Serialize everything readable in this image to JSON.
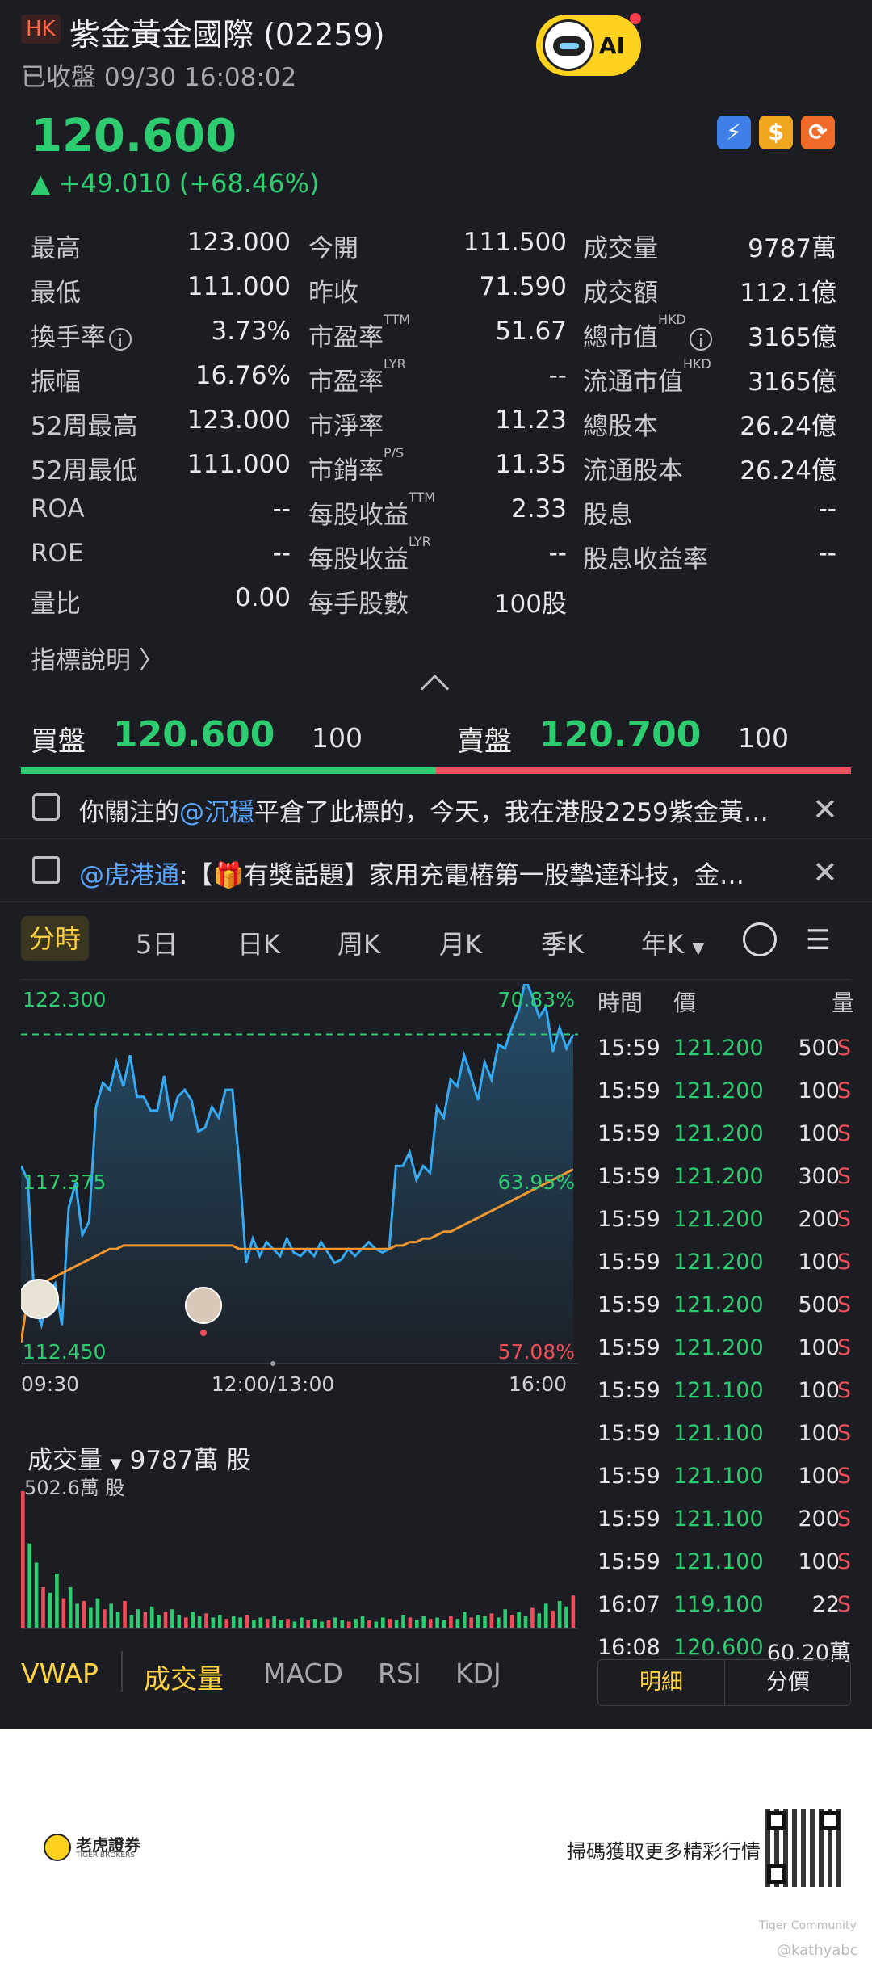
{
  "header": {
    "market": "HK",
    "title": "紫金黃金國際 (02259)",
    "status": "已收盤 09/30 16:08:02",
    "ai_label": "AI"
  },
  "quote": {
    "price": "120.600",
    "change": "▲ +49.010 (+68.46%)"
  },
  "stats": {
    "rows": [
      [
        {
          "l": "最高",
          "v": "123.000"
        },
        {
          "l": "今開",
          "v": "111.500"
        },
        {
          "l": "成交量",
          "v": "9787萬"
        }
      ],
      [
        {
          "l": "最低",
          "v": "111.000"
        },
        {
          "l": "昨收",
          "v": "71.590"
        },
        {
          "l": "成交額",
          "v": "112.1億"
        }
      ],
      [
        {
          "l": "換手率",
          "v": "3.73%"
        },
        {
          "l": "市盈率",
          "sup": "TTM",
          "v": "51.67"
        },
        {
          "l": "總市值",
          "sup": "HKD",
          "v": "3165億"
        }
      ],
      [
        {
          "l": "振幅",
          "v": "16.76%"
        },
        {
          "l": "市盈率",
          "sup": "LYR",
          "v": "--"
        },
        {
          "l": "流通市值",
          "sup": "HKD",
          "v": "3165億"
        }
      ],
      [
        {
          "l": "52周最高",
          "v": "123.000"
        },
        {
          "l": "市淨率",
          "v": "11.23"
        },
        {
          "l": "總股本",
          "v": "26.24億"
        }
      ],
      [
        {
          "l": "52周最低",
          "v": "111.000"
        },
        {
          "l": "市銷率",
          "sup": "P/S",
          "v": "11.35"
        },
        {
          "l": "流通股本",
          "v": "26.24億"
        }
      ],
      [
        {
          "l": "ROA",
          "v": "--"
        },
        {
          "l": "每股收益",
          "sup": "TTM",
          "v": "2.33"
        },
        {
          "l": "股息",
          "v": "--"
        }
      ],
      [
        {
          "l": "ROE",
          "v": "--"
        },
        {
          "l": "每股收益",
          "sup": "LYR",
          "v": "--"
        },
        {
          "l": "股息收益率",
          "v": "--"
        }
      ],
      [
        {
          "l": "量比",
          "v": "0.00"
        },
        {
          "l": "每手股數",
          "v": "100股"
        },
        {
          "l": "",
          "v": ""
        }
      ]
    ],
    "indicator_link": "指標說明 〉"
  },
  "orderbook": {
    "bid_label": "買盤",
    "bid_price": "120.600",
    "bid_qty": "100",
    "ask_label": "賣盤",
    "ask_price": "120.700",
    "ask_qty": "100"
  },
  "notices": [
    {
      "pre": "你關注的",
      "mention": "@沉穩",
      "post": "平倉了此標的，今天，我在港股2259紫金黃…"
    },
    {
      "pre": "",
      "mention": "@虎港通",
      "post": ":【🎁有獎話題】家用充電樁第一股摯達科技，金…"
    }
  ],
  "tabs": {
    "active": "分時",
    "items": [
      "5日",
      "日K",
      "周K",
      "月K",
      "季K",
      "年K"
    ]
  },
  "chart_data": {
    "type": "line",
    "x_ticks": [
      "09:30",
      "12:00/13:00",
      "16:00"
    ],
    "y_left": [
      "122.300",
      "117.375",
      "112.450"
    ],
    "y_right": [
      "70.83%",
      "63.95%",
      "57.08%"
    ],
    "ylim": [
      112.45,
      122.3
    ],
    "prev_close": 71.59,
    "series": [
      {
        "values": [
          117.6,
          117.2,
          113.6,
          113.0,
          113.9,
          114.2,
          113.0,
          116.4,
          117.1,
          115.6,
          116.0,
          119.3,
          120.0,
          119.8,
          120.6,
          119.9,
          120.8,
          119.6,
          119.6,
          119.2,
          119.2,
          120.2,
          118.9,
          119.6,
          119.8,
          119.5,
          118.6,
          118.7,
          119.3,
          119.0,
          119.8,
          119.8,
          117.7,
          114.8,
          115.5,
          115.0,
          115.4,
          115.2,
          115.0,
          115.5,
          115.1,
          115.0,
          115.2,
          115.0,
          115.4,
          115.1,
          114.8,
          114.9,
          115.2,
          115.0,
          115.2,
          115.4,
          115.2,
          115.1,
          115.2,
          117.6,
          117.6,
          118.0,
          117.2,
          117.6,
          117.4,
          119.3,
          119.0,
          120.1,
          119.9,
          120.8,
          120.2,
          119.5,
          120.6,
          120.1,
          121.1,
          121.0,
          121.6,
          122.1,
          123.0,
          122.5,
          121.9,
          122.2,
          120.9,
          121.6,
          121.0,
          121.4
        ]
      },
      {
        "values": [
          112.5,
          113.8,
          114.0,
          114.2,
          114.3,
          114.4,
          114.5,
          114.6,
          114.7,
          114.8,
          114.9,
          115.0,
          115.1,
          115.2,
          115.2,
          115.3,
          115.3,
          115.3,
          115.3,
          115.3,
          115.3,
          115.3,
          115.3,
          115.3,
          115.3,
          115.3,
          115.3,
          115.3,
          115.3,
          115.3,
          115.3,
          115.3,
          115.2,
          115.2,
          115.2,
          115.2,
          115.2,
          115.2,
          115.2,
          115.2,
          115.2,
          115.2,
          115.2,
          115.2,
          115.2,
          115.2,
          115.2,
          115.2,
          115.2,
          115.2,
          115.2,
          115.2,
          115.2,
          115.2,
          115.2,
          115.3,
          115.3,
          115.4,
          115.4,
          115.5,
          115.5,
          115.6,
          115.7,
          115.7,
          115.8,
          115.9,
          116.0,
          116.1,
          116.2,
          116.3,
          116.4,
          116.5,
          116.6,
          116.7,
          116.8,
          116.9,
          117.0,
          117.1,
          117.2,
          117.3,
          117.4,
          117.5
        ]
      }
    ],
    "dashed_level": 121.4
  },
  "volume": {
    "label": "成交量",
    "total": "9787萬 股",
    "max_label": "502.6萬 股",
    "bars": [
      100,
      62,
      48,
      30,
      26,
      40,
      22,
      30,
      18,
      20,
      15,
      22,
      14,
      18,
      12,
      20,
      10,
      14,
      12,
      16,
      10,
      12,
      14,
      10,
      8,
      12,
      9,
      11,
      8,
      10,
      7,
      9,
      8,
      10,
      6,
      8,
      7,
      9,
      6,
      7,
      5,
      8,
      6,
      7,
      5,
      6,
      8,
      6,
      5,
      7,
      9,
      6,
      5,
      8,
      7,
      6,
      10,
      8,
      6,
      9,
      7,
      8,
      6,
      9,
      7,
      12,
      8,
      10,
      9,
      11,
      8,
      14,
      10,
      12,
      9,
      15,
      11,
      18,
      13,
      20,
      16,
      24
    ]
  },
  "trades": {
    "headers": [
      "時間",
      "價",
      "量"
    ],
    "rows": [
      [
        "15:59",
        "121.200",
        "500",
        "S"
      ],
      [
        "15:59",
        "121.200",
        "100",
        "S"
      ],
      [
        "15:59",
        "121.200",
        "100",
        "S"
      ],
      [
        "15:59",
        "121.200",
        "300",
        "S"
      ],
      [
        "15:59",
        "121.200",
        "200",
        "S"
      ],
      [
        "15:59",
        "121.200",
        "100",
        "S"
      ],
      [
        "15:59",
        "121.200",
        "500",
        "S"
      ],
      [
        "15:59",
        "121.200",
        "100",
        "S"
      ],
      [
        "15:59",
        "121.100",
        "100",
        "S"
      ],
      [
        "15:59",
        "121.100",
        "100",
        "S"
      ],
      [
        "15:59",
        "121.100",
        "100",
        "S"
      ],
      [
        "15:59",
        "121.100",
        "200",
        "S"
      ],
      [
        "15:59",
        "121.100",
        "100",
        "S"
      ],
      [
        "16:07",
        "119.100",
        "22",
        "S"
      ],
      [
        "16:08",
        "120.600",
        "60.20萬",
        ""
      ]
    ],
    "seg_left": "明細",
    "seg_right": "分價"
  },
  "indicators": {
    "vwap": "VWAP",
    "volume": "成交量",
    "macd": "MACD",
    "rsi": "RSI",
    "kdj": "KDJ"
  },
  "footer": {
    "brand": "老虎證券",
    "brand_sub": "TIGER BROKERS",
    "slogan": "掃碼獲取更多精彩行情",
    "community": "Tiger Community",
    "user": "@kathyabc"
  },
  "colors": {
    "up": "#2ecc71",
    "down": "#ef4d5a",
    "accent": "#ffd23f",
    "vwap": "#f0962e",
    "price_line": "#36a9f0"
  }
}
